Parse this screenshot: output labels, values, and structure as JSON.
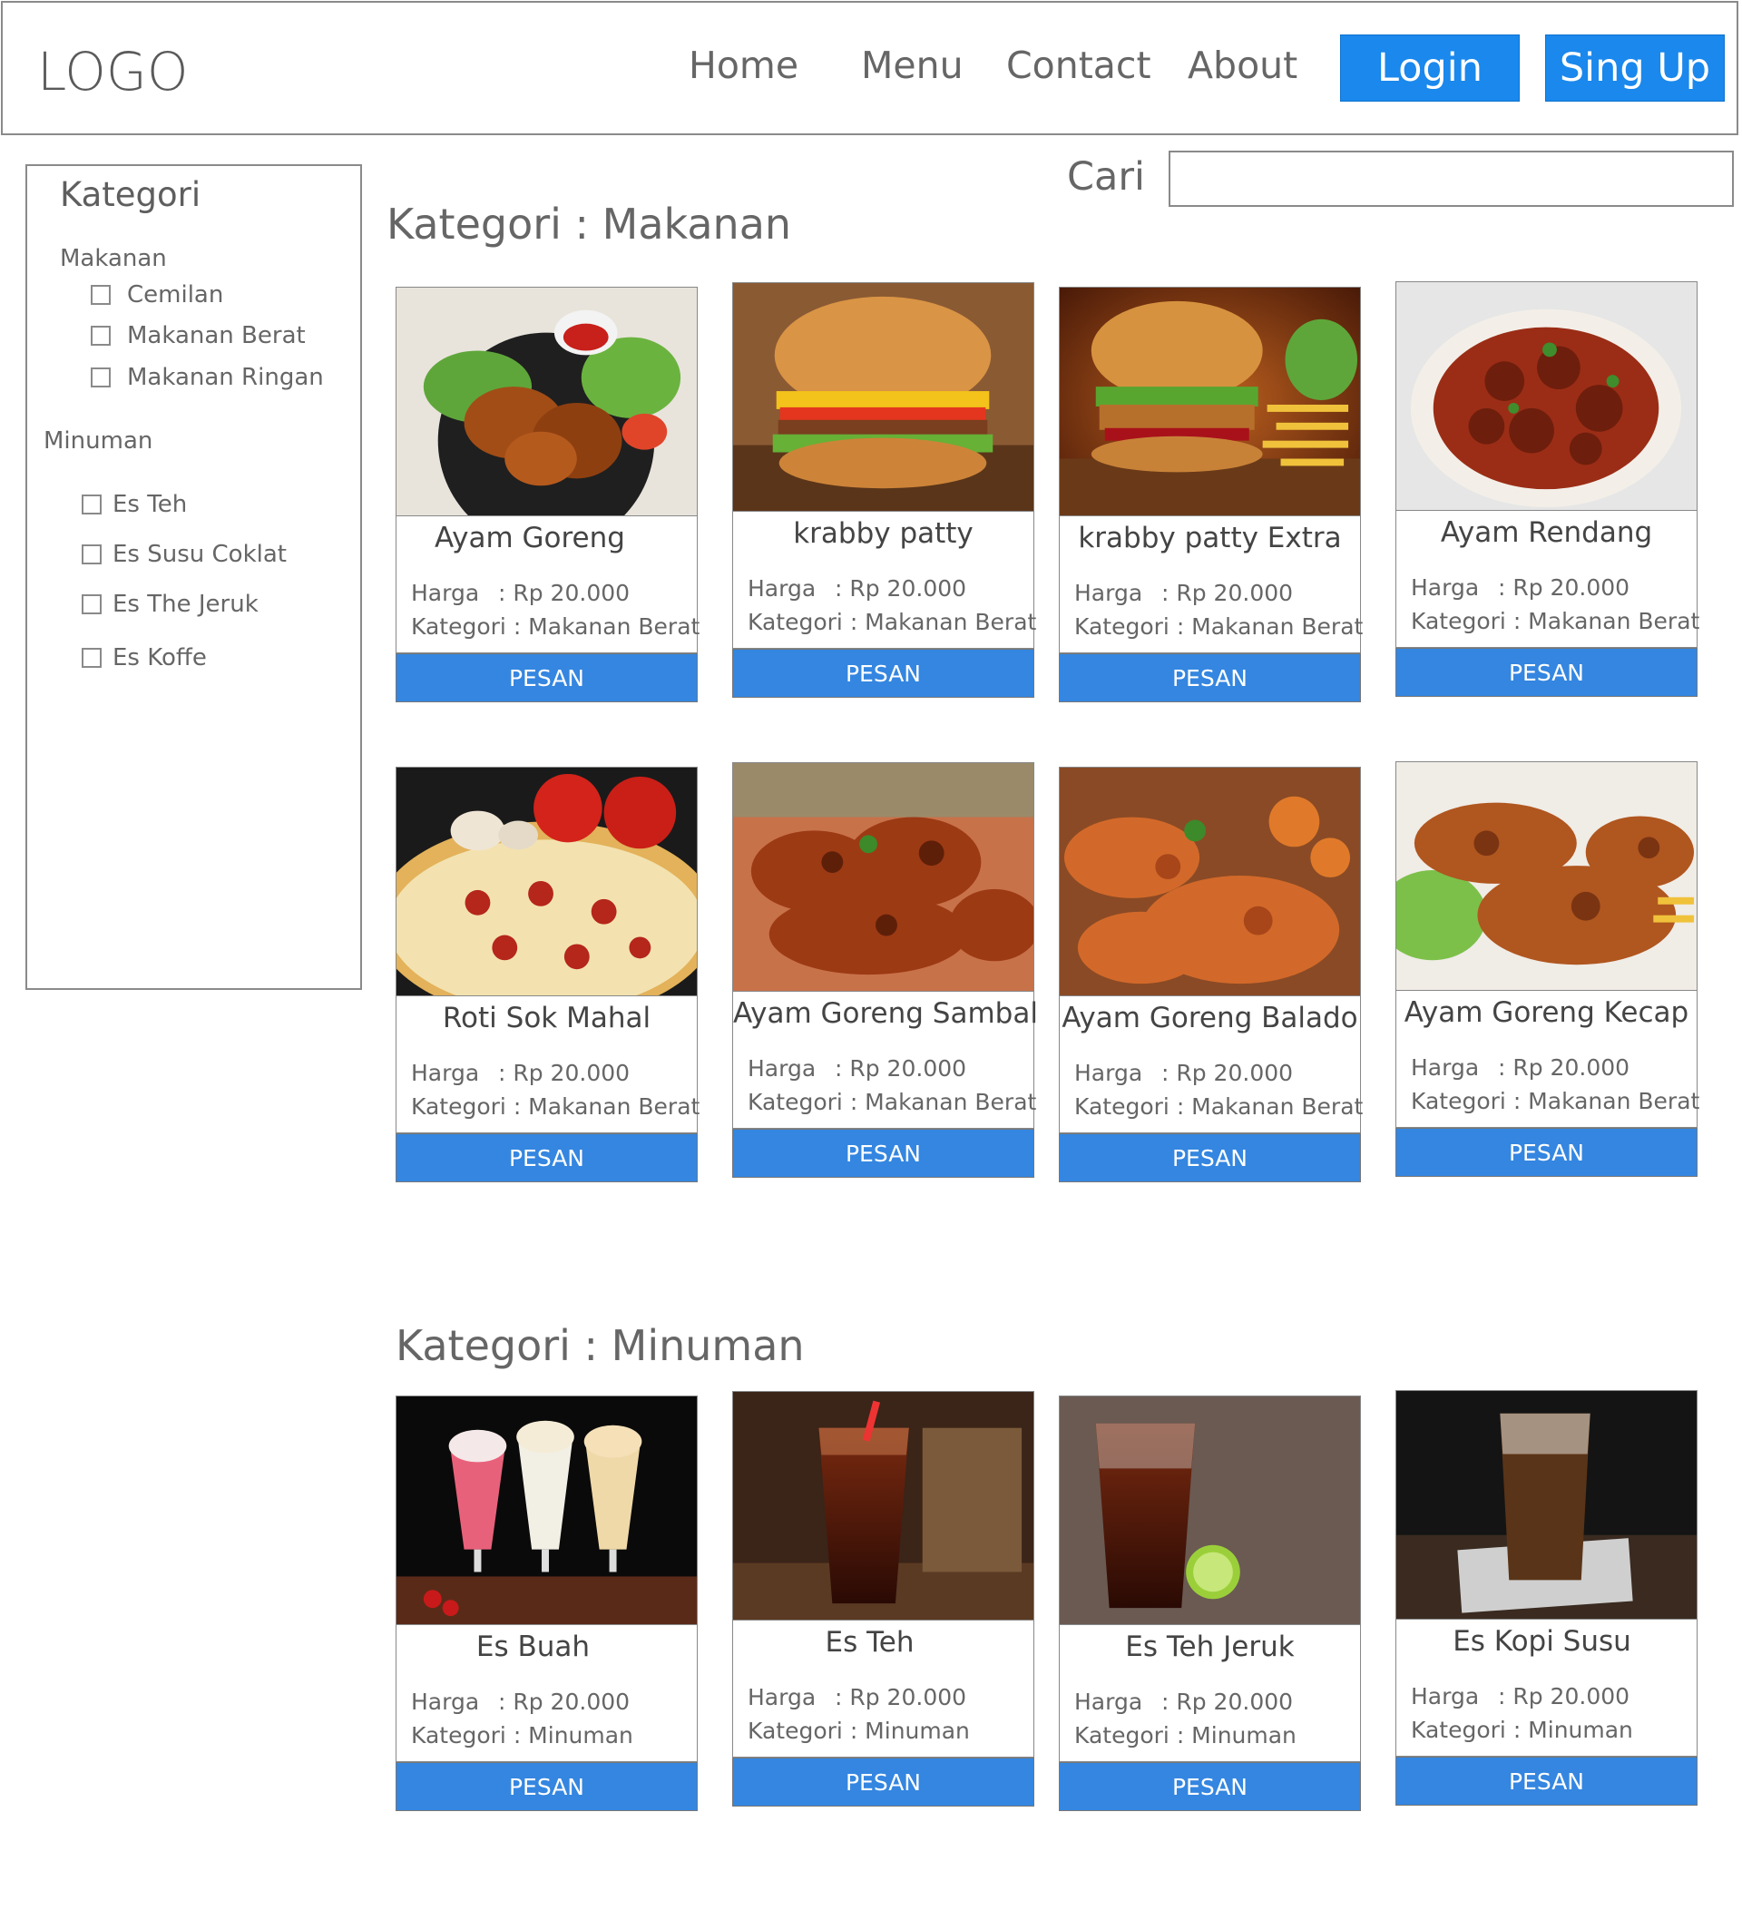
{
  "header": {
    "logo": "LOGO",
    "nav": [
      "Home",
      "Menu",
      "Contact",
      "About"
    ],
    "login_label": "Login",
    "signup_label": "Sing Up"
  },
  "sidebar": {
    "title": "Kategori",
    "groups": [
      {
        "label": "Makanan",
        "items": [
          "Cemilan",
          "Makanan Berat",
          "Makanan Ringan"
        ]
      },
      {
        "label": "Minuman",
        "items": [
          "Es Teh",
          "Es Susu Coklat",
          "Es The Jeruk",
          "Es Koffe"
        ]
      }
    ]
  },
  "search": {
    "label": "Cari",
    "value": "",
    "placeholder": ""
  },
  "sections": [
    {
      "title": "Kategori : Makanan",
      "items": [
        {
          "name": "Ayam Goreng",
          "price_label": "Harga",
          "price": ": Rp 20.000",
          "category_label": "Kategori",
          "category": ": Makanan Berat",
          "button": "PESAN",
          "image": "fried-chicken-photo"
        },
        {
          "name": "krabby patty",
          "price_label": "Harga",
          "price": ": Rp 20.000",
          "category_label": "Kategori",
          "category": ": Makanan Berat",
          "button": "PESAN",
          "image": "burger-photo"
        },
        {
          "name": "krabby patty Extra",
          "price_label": "Harga",
          "price": ": Rp 20.000",
          "category_label": "Kategori",
          "category": ": Makanan Berat",
          "button": "PESAN",
          "image": "burger-fries-photo"
        },
        {
          "name": "Ayam Rendang",
          "price_label": "Harga",
          "price": ": Rp 20.000",
          "category_label": "Kategori",
          "category": ": Makanan Berat",
          "button": "PESAN",
          "image": "chicken-rendang-photo"
        },
        {
          "name": "Roti Sok Mahal",
          "price_label": "Harga",
          "price": ": Rp 20.000",
          "category_label": "Kategori",
          "category": ": Makanan Berat",
          "button": "PESAN",
          "image": "pizza-photo"
        },
        {
          "name": "Ayam Goreng Sambal",
          "price_label": "Harga",
          "price": ": Rp 20.000",
          "category_label": "Kategori",
          "category": ": Makanan Berat",
          "button": "PESAN",
          "image": "spicy-chicken-photo"
        },
        {
          "name": "Ayam Goreng Balado",
          "price_label": "Harga",
          "price": ": Rp 20.000",
          "category_label": "Kategori",
          "category": ": Makanan Berat",
          "button": "PESAN",
          "image": "chicken-balado-photo"
        },
        {
          "name": "Ayam Goreng Kecap",
          "price_label": "Harga",
          "price": ": Rp 20.000",
          "category_label": "Kategori",
          "category": ": Makanan Berat",
          "button": "PESAN",
          "image": "chicken-kecap-photo"
        }
      ]
    },
    {
      "title": "Kategori : Minuman",
      "items": [
        {
          "name": "Es Buah",
          "price_label": "Harga",
          "price": ": Rp 20.000",
          "category_label": "Kategori",
          "category": ": Minuman",
          "button": "PESAN",
          "image": "milkshakes-photo"
        },
        {
          "name": "Es Teh",
          "price_label": "Harga",
          "price": ": Rp 20.000",
          "category_label": "Kategori",
          "category": ": Minuman",
          "button": "PESAN",
          "image": "iced-tea-photo"
        },
        {
          "name": "Es Teh Jeruk",
          "price_label": "Harga",
          "price": ": Rp 20.000",
          "category_label": "Kategori",
          "category": ": Minuman",
          "button": "PESAN",
          "image": "iced-tea-lime-photo"
        },
        {
          "name": "Es Kopi Susu",
          "price_label": "Harga",
          "price": ": Rp 20.000",
          "category_label": "Kategori",
          "category": ": Minuman",
          "button": "PESAN",
          "image": "iced-coffee-photo"
        }
      ]
    }
  ],
  "colors": {
    "accent": "#1a88ec",
    "button": "#3486e0",
    "border": "#8a8a8a",
    "text": "#666666"
  }
}
